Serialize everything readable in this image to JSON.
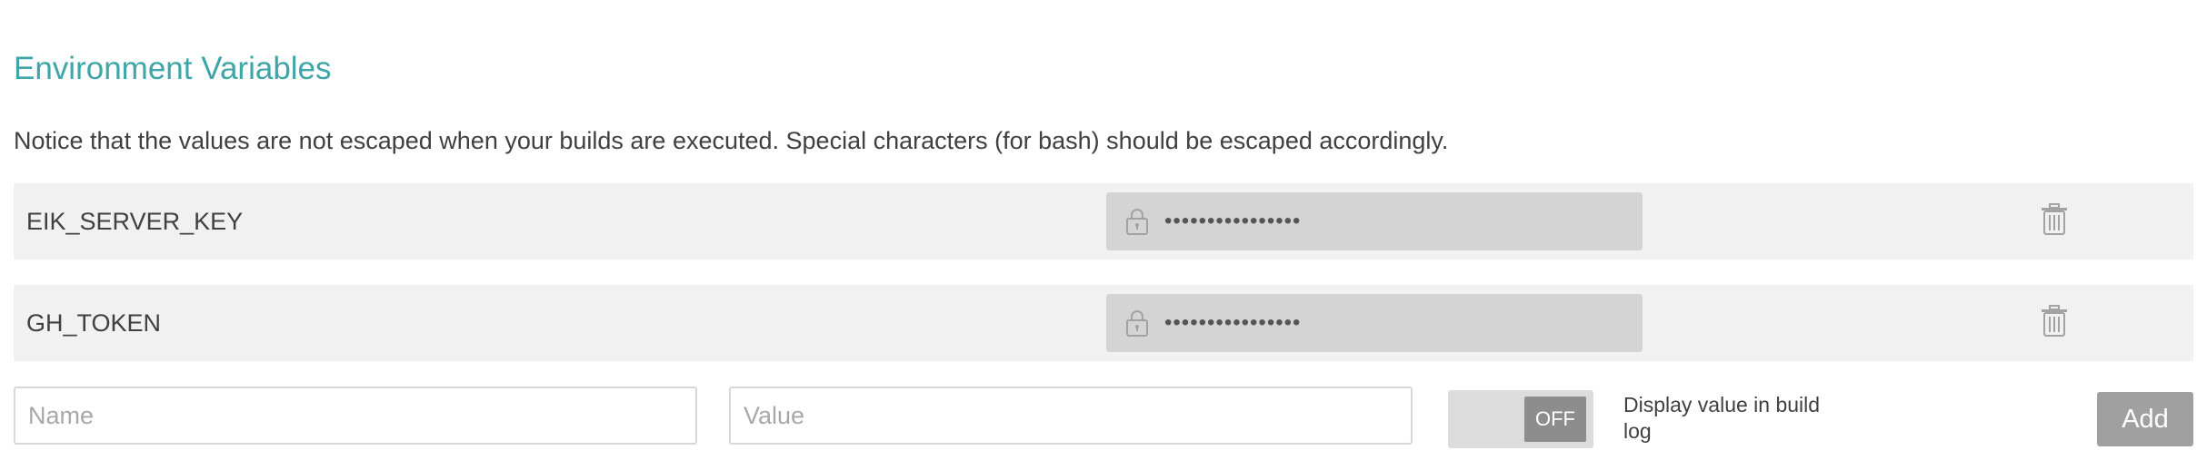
{
  "section": {
    "title": "Environment Variables",
    "notice": "Notice that the values are not escaped when your builds are executed. Special characters (for bash) should be escaped accordingly."
  },
  "variables": [
    {
      "name": "EIK_SERVER_KEY",
      "masked_value": "••••••••••••••••",
      "value_icon": "lock-icon",
      "delete_icon": "trash-icon"
    },
    {
      "name": "GH_TOKEN",
      "masked_value": "••••••••••••••••",
      "value_icon": "lock-icon",
      "delete_icon": "trash-icon"
    }
  ],
  "new_variable": {
    "name_placeholder": "Name",
    "value_placeholder": "Value",
    "toggle_state": "OFF",
    "toggle_label": "Display value in build log",
    "add_label": "Add"
  },
  "colors": {
    "accent": "#3ea6a8",
    "row_background": "#f1f1f1",
    "value_background": "#d4d4d4",
    "button_background": "#a0a0a0",
    "toggle_knob": "#8d8d8d"
  }
}
